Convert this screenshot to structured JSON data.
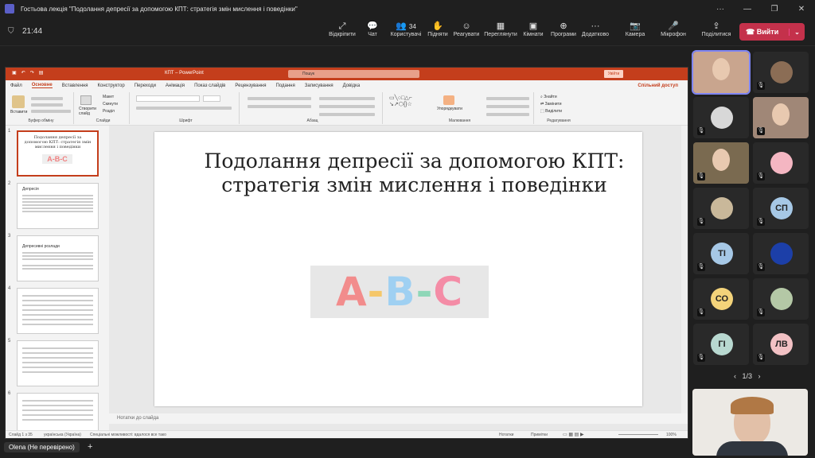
{
  "window": {
    "title": "Гостьова лекція \"Подолання депресії за допомогою КПТ: стратегія змін мислення і поведінки\"",
    "controls": [
      "···",
      "—",
      "❐",
      "✕"
    ]
  },
  "meeting": {
    "time": "21:44",
    "buttons": [
      {
        "label": "Відкріпити",
        "icon": "unpin-icon",
        "glyph": "⤢"
      },
      {
        "label": "Чат",
        "icon": "chat-icon",
        "glyph": "💬"
      },
      {
        "label": "Користувачі",
        "icon": "people-icon",
        "glyph": "👥",
        "count": "34"
      },
      {
        "label": "Підняти",
        "icon": "raise-hand-icon",
        "glyph": "✋"
      },
      {
        "label": "Реагувати",
        "icon": "react-icon",
        "glyph": "☺"
      },
      {
        "label": "Переглянути",
        "icon": "view-icon",
        "glyph": "▦"
      },
      {
        "label": "Кімнати",
        "icon": "rooms-icon",
        "glyph": "▣"
      },
      {
        "label": "Програми",
        "icon": "apps-icon",
        "glyph": "⊕"
      },
      {
        "label": "Додатково",
        "icon": "more-icon",
        "glyph": "···"
      },
      {
        "label": "Камера",
        "icon": "camera-icon",
        "glyph": "📷"
      },
      {
        "label": "Мікрофон",
        "icon": "microphone-icon",
        "glyph": "🎤"
      },
      {
        "label": "Поділитися",
        "icon": "share-icon",
        "glyph": "⇪"
      }
    ],
    "leave_label": "Вийти",
    "leave_color": "#c4314b"
  },
  "ppt": {
    "filename": "КПТ – PowerPoint",
    "search_placeholder": "Пошук",
    "account": "Увійти",
    "menu": [
      "Файл",
      "Основне",
      "Вставлення",
      "Конструктор",
      "Переходи",
      "Анімація",
      "Показ слайдів",
      "Рецензування",
      "Подання",
      "Записування",
      "Довідка"
    ],
    "active_menu": "Основне",
    "share": "Спільний доступ",
    "ribbon_groups": [
      "Буфер обміну",
      "Слайди",
      "Шрифт",
      "Абзац",
      "Малювання",
      "Редагування"
    ],
    "ribbon_items": {
      "paste": "Вставити",
      "new_slide": "Створити слайд",
      "layout": "Макет",
      "reset": "Скинути",
      "section": "Розділ",
      "arrange": "Упорядкувати",
      "find": "Знайти",
      "replace": "Замінити",
      "select": "Виділити"
    },
    "slide_numbers": [
      "1",
      "2",
      "3",
      "4",
      "5",
      "6"
    ],
    "thumb_texts": {
      "s1": "Подолання депресії за допомогою КПТ: стратегія змін мислення і поведінки",
      "s2": "Депресія",
      "s3": "Депресивні розлади"
    },
    "slide_title": "Подолання депресії за допомогою КПТ: стратегія змін мислення і поведінки",
    "slide_image_text": "A-B-C",
    "notes_placeholder": "Нотатки до слайда",
    "status_left": "Слайд 1 з 35",
    "status_lang": "українська (Україна)",
    "status_access": "Спеціальні можливості: вдалося все тако",
    "status_notes": "Нотатки",
    "status_comments": "Примітки",
    "zoom": "100%"
  },
  "participants": [
    {
      "initials": "",
      "kind": "video",
      "color": "#c9a58e"
    },
    {
      "initials": "",
      "kind": "avatar",
      "color": "#8b6d55"
    },
    {
      "initials": "",
      "kind": "avatar",
      "color": "#d8d8d8"
    },
    {
      "initials": "",
      "kind": "video",
      "color": "#a08777"
    },
    {
      "initials": "",
      "kind": "video",
      "color": "#7a6a50"
    },
    {
      "initials": "",
      "kind": "avatar",
      "color": "#f4b6c2"
    },
    {
      "initials": "",
      "kind": "avatar",
      "color": "#c9b89a"
    },
    {
      "initials": "СП",
      "kind": "initials",
      "color": "#a6c8e6"
    },
    {
      "initials": "ТІ",
      "kind": "initials",
      "color": "#a6c8e6"
    },
    {
      "initials": "",
      "kind": "avatar",
      "color": "#1c3fa8"
    },
    {
      "initials": "СО",
      "kind": "initials",
      "color": "#f3d37a"
    },
    {
      "initials": "",
      "kind": "avatar",
      "color": "#b4c8a6"
    },
    {
      "initials": "ГІ",
      "kind": "initials",
      "color": "#b8d8d0"
    },
    {
      "initials": "ЛВ",
      "kind": "initials",
      "color": "#f2c1c4"
    }
  ],
  "pager": "1/3",
  "self_name": "Olena (Не перевірено)"
}
